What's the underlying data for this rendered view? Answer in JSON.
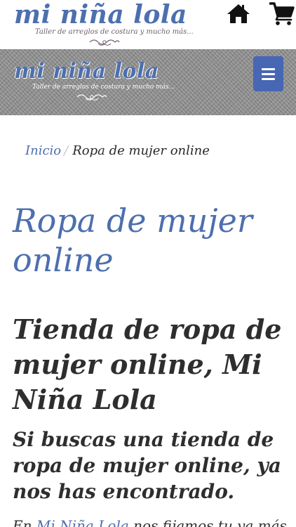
{
  "header": {
    "logo": {
      "title": "mi niña lola",
      "tagline": "Taller de arreglos de costura y mucho más..."
    },
    "icons": {
      "home": "home-icon",
      "cart": "cart-icon"
    }
  },
  "banner": {
    "logo": {
      "title": "mi niña lola",
      "tagline": "Taller de arreglos de costura y mucho más..."
    },
    "menu_icon": "hamburger-menu-icon"
  },
  "breadcrumb": {
    "home_label": "Inicio",
    "separator": "/",
    "current_label": "Ropa de mujer online"
  },
  "content": {
    "page_title": "Ropa de mujer online",
    "shop_heading": "Tienda de ropa de mujer online, Mi Niña Lola",
    "sub_heading": "Si buscas una tienda de ropa de mujer online, ya nos has encontrado.",
    "intro_prefix": "En",
    "intro_link": "Mi Niña Lola",
    "intro_suffix": "nos fijamos tu ya más"
  },
  "colors": {
    "brand_blue": "#4d6fae",
    "menu_button": "#4766b4",
    "text_dark": "#2e2e2e",
    "banner_gray": "#8e8e8e"
  }
}
